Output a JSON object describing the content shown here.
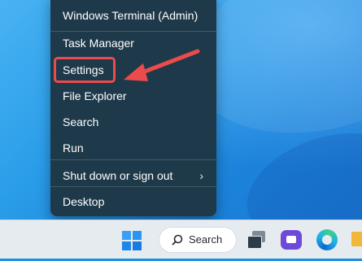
{
  "menu": {
    "items": [
      {
        "label": "Windows Terminal (Admin)"
      },
      {
        "label": "Task Manager"
      },
      {
        "label": "Settings"
      },
      {
        "label": "File Explorer"
      },
      {
        "label": "Search"
      },
      {
        "label": "Run"
      },
      {
        "label": "Shut down or sign out",
        "submenu_arrow": "›"
      },
      {
        "label": "Desktop"
      }
    ]
  },
  "taskbar": {
    "search_label": "Search",
    "icons": [
      "windows-start-icon",
      "search-icon",
      "task-view-icon",
      "chat-icon",
      "edge-browser-icon",
      "file-explorer-icon"
    ]
  },
  "colors": {
    "menu_bg": "#1e3a4a",
    "highlight": "#ec4b4b",
    "taskbar_bg": "#e6ebf0",
    "accent": "#1a8bf0"
  }
}
